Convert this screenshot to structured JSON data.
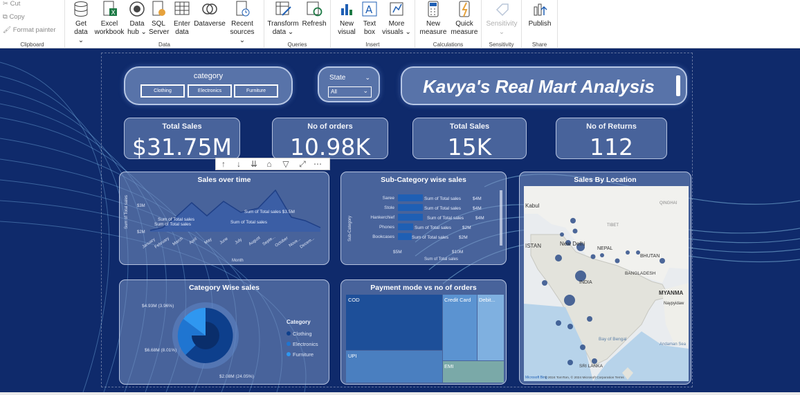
{
  "ribbon": {
    "clipboard": {
      "cut": "Cut",
      "copy": "Copy",
      "format_painter": "Format painter",
      "group": "Clipboard"
    },
    "data_group": "Data",
    "queries_group": "Queries",
    "insert_group": "Insert",
    "calculations_group": "Calculations",
    "sensitivity_group": "Sensitivity",
    "share_group": "Share",
    "buttons": {
      "get_data": [
        "Get",
        "data ⌄"
      ],
      "excel": [
        "Excel",
        "workbook"
      ],
      "data_hub": [
        "Data",
        "hub ⌄"
      ],
      "sql": [
        "SQL",
        "Server"
      ],
      "enter_data": [
        "Enter",
        "data"
      ],
      "dataverse": [
        "Dataverse",
        ""
      ],
      "recent": [
        "Recent",
        "sources ⌄"
      ],
      "transform": [
        "Transform",
        "data ⌄"
      ],
      "refresh": [
        "Refresh",
        ""
      ],
      "new_visual": [
        "New",
        "visual"
      ],
      "text_box": [
        "Text",
        "box"
      ],
      "more_visuals": [
        "More",
        "visuals ⌄"
      ],
      "new_measure": [
        "New",
        "measure"
      ],
      "quick_measure": [
        "Quick",
        "measure"
      ],
      "sensitivity": [
        "Sensitivity",
        "⌄"
      ],
      "publish": [
        "Publish",
        ""
      ]
    }
  },
  "slicer": {
    "title": "category",
    "options": [
      "Clothing",
      "Electronics",
      "Furniture"
    ]
  },
  "state": {
    "title": "State",
    "value": "All"
  },
  "report_title": "Kavya's Real Mart Analysis",
  "kpis": [
    {
      "label": "Total Sales",
      "value": "$31.75M"
    },
    {
      "label": "No of orders",
      "value": "10.98K"
    },
    {
      "label": "Total Sales",
      "value": "15K"
    },
    {
      "label": "No of Returns",
      "value": "112"
    }
  ],
  "visual_toolbar": [
    "↑",
    "↓",
    "⇊",
    "⌂",
    "▽",
    "⤢",
    "⋯"
  ],
  "sales_over_time": {
    "title": "Sales over time",
    "xlabel": "Month",
    "ylabel": "Sum of Total sales",
    "yticks": [
      "$3M",
      "$2M"
    ],
    "months": [
      "January",
      "February",
      "March",
      "April",
      "May",
      "June",
      "July",
      "August",
      "Septe...",
      "October",
      "Nove...",
      "Decem..."
    ],
    "tooltips": [
      "Sum of Total sales",
      "Sum of Total sales",
      "Sum of Total sales",
      "Sum of Total sales $3.5M"
    ]
  },
  "subcategory": {
    "title": "Sub-Category wise sales",
    "ylabel": "Sub-Category",
    "xlabel": "Sum of Total sales",
    "xticks": [
      "$5M",
      "$10M"
    ],
    "rows": [
      {
        "name": "Saree",
        "label": "Sum of Total sales",
        "value_text": "$4M"
      },
      {
        "name": "Stole",
        "label": "Sum of Total sales",
        "value_text": "$4M"
      },
      {
        "name": "Hankerchief",
        "label": "Sum of Total sales",
        "value_text": "$4M"
      },
      {
        "name": "Phones",
        "label": "Sum of Total sales",
        "value_text": "$2M"
      },
      {
        "name": "Bookcases",
        "label": "Sum of Total sales",
        "value_text": "$2M"
      }
    ]
  },
  "category_wise": {
    "title": "Category Wise sales",
    "legend_title": "Category",
    "legend": [
      "Clothing",
      "Electronics",
      "Furniture"
    ],
    "labels": [
      "$4.93M (3.96%)",
      "$6.68M (8.01%)",
      "$2.08M (24.05%)"
    ]
  },
  "payment": {
    "title": "Payment mode vs no of orders",
    "blocks": [
      "COD",
      "UPI",
      "Credit Card",
      "Debit...",
      "EMI"
    ]
  },
  "map": {
    "title": "Sales By Location",
    "places": [
      "Kabul",
      "TIBET",
      "QINGHAI",
      "New Delhi",
      "NEPAL",
      "BHUTAN",
      "INDIA",
      "BANGLADESH",
      "MYANMA",
      "Naypyidaw",
      "Bay of Bengal",
      "Andaman Sea",
      "SRI LANKA",
      "ISTAN"
    ],
    "copyright": "© 2024 TomTom, © 2024 Microsoft Corporation  Terms",
    "logo": "Microsoft Bing"
  },
  "colors": {
    "background": "#0f2a6b",
    "accent": "#1f5fb4",
    "treemap_dark": "#1d4f99"
  }
}
